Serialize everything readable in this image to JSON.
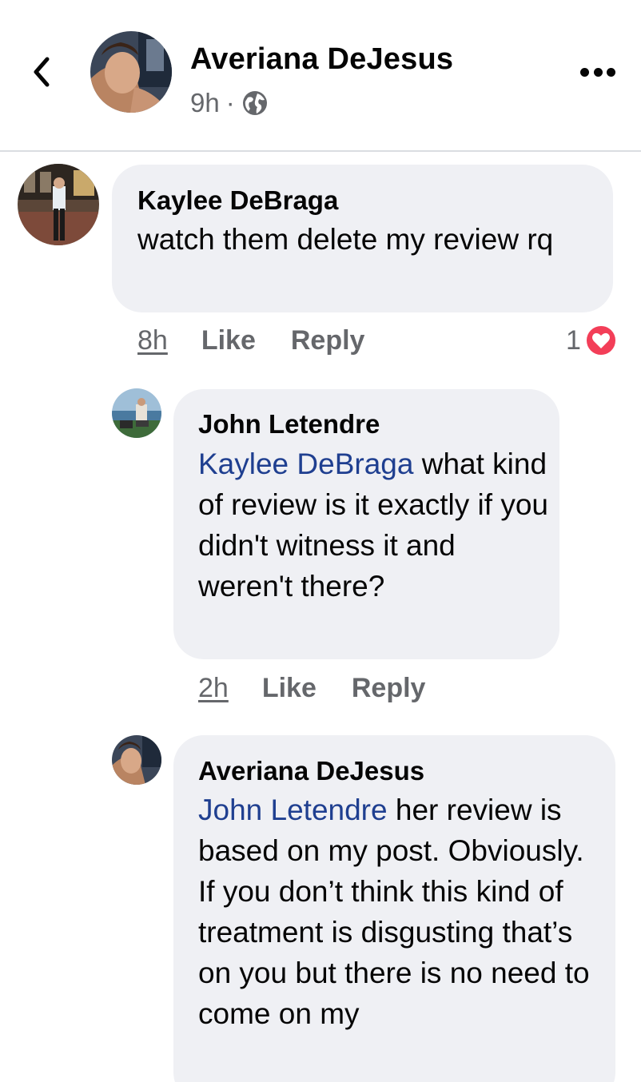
{
  "post_header": {
    "author": "Averiana DeJesus",
    "time": "9h",
    "separator": "·",
    "icons": {
      "back": "chevron-left-icon",
      "audience": "globe-icon",
      "more": "more-horizontal-icon"
    }
  },
  "comments": [
    {
      "author": "Kaylee DeBraga",
      "mention": "",
      "text": "watch them delete my review rq",
      "time": "8h",
      "like_label": "Like",
      "reply_label": "Reply",
      "reaction_count": "1",
      "reaction_type": "heart-icon"
    },
    {
      "author": "John Letendre",
      "mention": "Kaylee DeBraga",
      "text": " what kind  of review is it exactly if you  didn't witness it and weren't there?",
      "time": "2h",
      "like_label": "Like",
      "reply_label": "Reply"
    },
    {
      "author": "Averiana DeJesus",
      "mention": "John Letendre",
      "text": " her review is based on my post. Obviously. If you don’t think this kind of treatment is disgusting that’s on you but there is no need to come on my"
    }
  ],
  "colors": {
    "bubble": "#eff0f4",
    "secondary_text": "#65676b",
    "mention": "#1f3f90",
    "reaction_heart": "#f33e58"
  }
}
